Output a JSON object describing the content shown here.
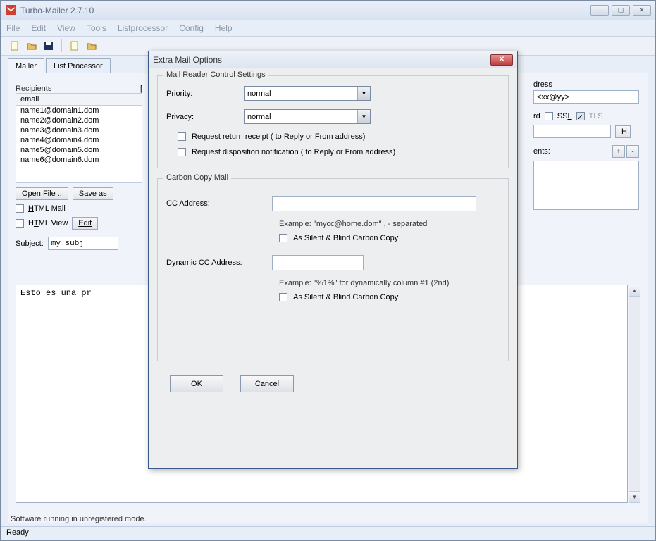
{
  "window": {
    "title": "Turbo-Mailer 2.7.10"
  },
  "menubar": [
    "File",
    "Edit",
    "View",
    "Tools",
    "Listprocessor",
    "Config",
    "Help"
  ],
  "tabs": {
    "mailer": "Mailer",
    "listproc": "List Processor"
  },
  "recipients": {
    "label": "Recipients",
    "header": "email",
    "items": [
      "name1@domain1.dom",
      "name2@domain2.dom",
      "name3@domain3.dom",
      "name4@domain4.dom",
      "name5@domain5.dom",
      "name6@domain6.dom"
    ],
    "open_btn": "Open File ..",
    "save_btn": "Save as"
  },
  "options": {
    "html_mail": "HTML Mail",
    "html_view": "HTML View",
    "edit_btn": "Edit"
  },
  "subject": {
    "label": "Subject:",
    "value": "my subj"
  },
  "body": "Esto es una pr",
  "right": {
    "address_lbl": "dress",
    "address_val": "<xx@yy>",
    "rd_lbl": "rd",
    "ssl": "SSL",
    "tls": "TLS",
    "h_btn": "H",
    "ents": "ents:",
    "plus": "+",
    "minus": "-"
  },
  "status1": "Software running in unregistered mode.",
  "status2": "Ready",
  "dialog": {
    "title": "Extra Mail Options",
    "group1": {
      "legend": "Mail Reader Control Settings",
      "priority_lbl": "Priority:",
      "priority_val": "normal",
      "privacy_lbl": "Privacy:",
      "privacy_val": "normal",
      "receipt": "Request return receipt  ( to Reply or From address)",
      "disposition": "Request disposition notification  ( to Reply or From address)"
    },
    "group2": {
      "legend": "Carbon Copy Mail",
      "cc_lbl": "CC Address:",
      "cc_example": "Example: \"mycc@home.dom\"    , - separated",
      "cc_silent": "As Silent & Blind Carbon Copy",
      "dyn_lbl": "Dynamic CC Address:",
      "dyn_example": "Example: \"%1%\" for dynamically column #1 (2nd)",
      "dyn_silent": "As Silent & Blind Carbon Copy"
    },
    "ok": "OK",
    "cancel": "Cancel"
  }
}
